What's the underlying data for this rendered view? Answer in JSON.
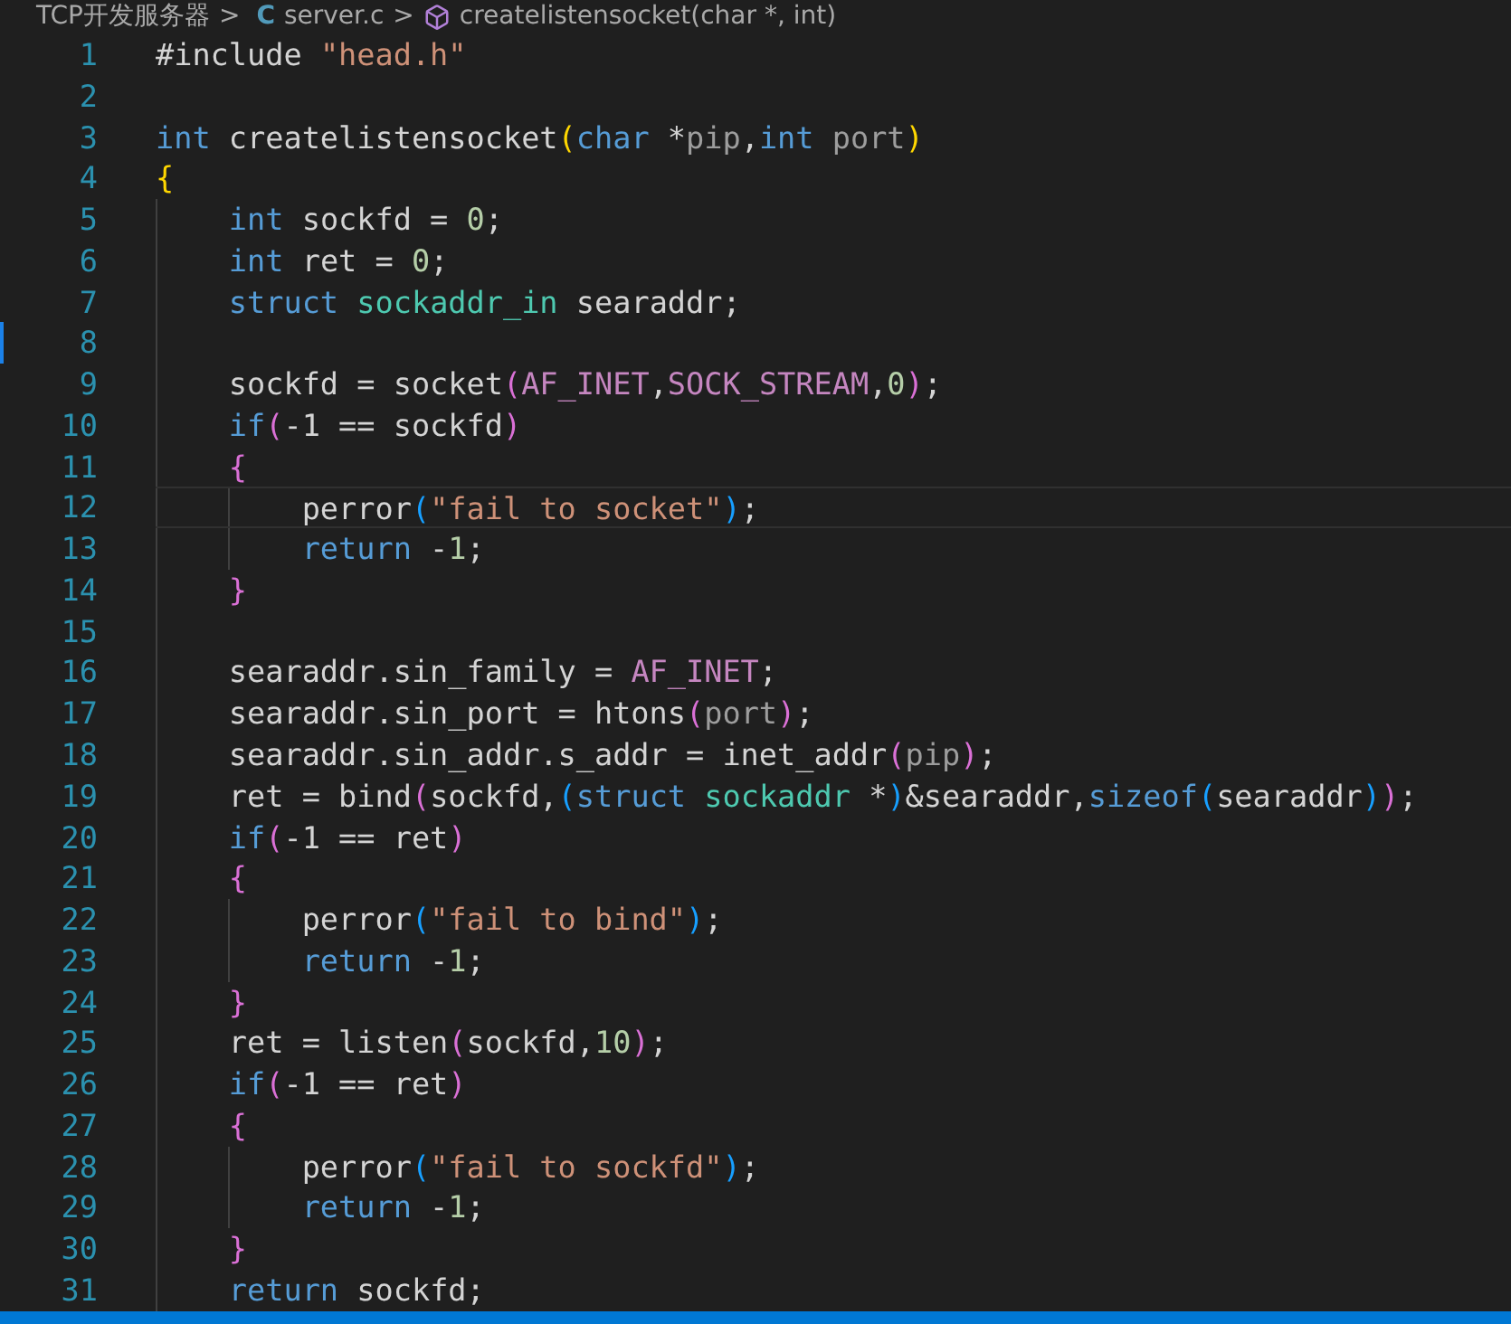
{
  "breadcrumb": [
    {
      "kind": "folder",
      "text": "TCP开发服务器"
    },
    {
      "kind": "c-file",
      "icon": "C",
      "text": "server.c"
    },
    {
      "kind": "symbol",
      "text": "createlistensocket(char *, int)"
    }
  ],
  "separator": ">",
  "lines": [
    {
      "number": "1",
      "tokens": [
        {
          "kind": "plain",
          "text": "#include "
        },
        {
          "kind": "string",
          "text": "\"head.h\""
        }
      ]
    },
    {
      "number": "2"
    },
    {
      "number": "3",
      "tokens": [
        {
          "kind": "keyword",
          "text": "int"
        },
        {
          "kind": "plain",
          "text": " createlistensocket"
        },
        {
          "kind": "bracket1",
          "text": "("
        },
        {
          "kind": "keyword",
          "text": "char"
        },
        {
          "kind": "plain",
          "text": " *"
        },
        {
          "kind": "param",
          "text": "pip"
        },
        {
          "kind": "plain",
          "text": ","
        },
        {
          "kind": "keyword",
          "text": "int"
        },
        {
          "kind": "param",
          "text": " port"
        },
        {
          "kind": "bracket1",
          "text": ")"
        }
      ]
    },
    {
      "number": "4",
      "tokens": [
        {
          "kind": "bracket1",
          "text": "{"
        }
      ]
    },
    {
      "number": "5",
      "tokens": [
        {
          "kind": "keyword",
          "text": "    int"
        },
        {
          "kind": "plain",
          "text": " sockfd = "
        },
        {
          "kind": "number",
          "text": "0"
        },
        {
          "kind": "plain",
          "text": ";"
        }
      ]
    },
    {
      "number": "6",
      "tokens": [
        {
          "kind": "keyword",
          "text": "    int"
        },
        {
          "kind": "plain",
          "text": " ret = "
        },
        {
          "kind": "number",
          "text": "0"
        },
        {
          "kind": "plain",
          "text": ";"
        }
      ]
    },
    {
      "number": "7",
      "tokens": [
        {
          "kind": "keyword",
          "text": "    struct"
        },
        {
          "kind": "type",
          "text": " sockaddr_in"
        },
        {
          "kind": "plain",
          "text": " searaddr;"
        }
      ]
    },
    {
      "number": "8",
      "change_marker": true
    },
    {
      "number": "9",
      "tokens": [
        {
          "kind": "plain",
          "text": "    sockfd = socket"
        },
        {
          "kind": "bracket2",
          "text": "("
        },
        {
          "kind": "macro",
          "text": "AF_INET"
        },
        {
          "kind": "plain",
          "text": ","
        },
        {
          "kind": "macro",
          "text": "SOCK_STREAM"
        },
        {
          "kind": "plain",
          "text": ","
        },
        {
          "kind": "number",
          "text": "0"
        },
        {
          "kind": "bracket2",
          "text": ")"
        },
        {
          "kind": "plain",
          "text": ";"
        }
      ]
    },
    {
      "number": "10",
      "tokens": [
        {
          "kind": "keyword",
          "text": "    if"
        },
        {
          "kind": "bracket2",
          "text": "("
        },
        {
          "kind": "plain",
          "text": "-1 == sockfd"
        },
        {
          "kind": "bracket2",
          "text": ")"
        }
      ]
    },
    {
      "number": "11",
      "tokens": [
        {
          "kind": "bracket2",
          "text": "    {"
        }
      ]
    },
    {
      "number": "12",
      "current": true,
      "tokens": [
        {
          "kind": "plain",
          "text": "        perror"
        },
        {
          "kind": "bracket3",
          "text": "("
        },
        {
          "kind": "string",
          "text": "\"fail to socket\""
        },
        {
          "kind": "bracket3",
          "text": ")"
        },
        {
          "kind": "plain",
          "text": ";"
        }
      ]
    },
    {
      "number": "13",
      "tokens": [
        {
          "kind": "keyword",
          "text": "        return"
        },
        {
          "kind": "plain",
          "text": " -"
        },
        {
          "kind": "number",
          "text": "1"
        },
        {
          "kind": "plain",
          "text": ";"
        }
      ]
    },
    {
      "number": "14",
      "tokens": [
        {
          "kind": "bracket2",
          "text": "    }"
        }
      ]
    },
    {
      "number": "15"
    },
    {
      "number": "16",
      "tokens": [
        {
          "kind": "plain",
          "text": "    searaddr.sin_family = "
        },
        {
          "kind": "macro",
          "text": "AF_INET"
        },
        {
          "kind": "plain",
          "text": ";"
        }
      ]
    },
    {
      "number": "17",
      "tokens": [
        {
          "kind": "plain",
          "text": "    searaddr.sin_port = htons"
        },
        {
          "kind": "bracket2",
          "text": "("
        },
        {
          "kind": "param",
          "text": "port"
        },
        {
          "kind": "bracket2",
          "text": ")"
        },
        {
          "kind": "plain",
          "text": ";"
        }
      ]
    },
    {
      "number": "18",
      "tokens": [
        {
          "kind": "plain",
          "text": "    searaddr.sin_addr.s_addr = inet_addr"
        },
        {
          "kind": "bracket2",
          "text": "("
        },
        {
          "kind": "param",
          "text": "pip"
        },
        {
          "kind": "bracket2",
          "text": ")"
        },
        {
          "kind": "plain",
          "text": ";"
        }
      ]
    },
    {
      "number": "19",
      "tokens": [
        {
          "kind": "plain",
          "text": "    ret = bind"
        },
        {
          "kind": "bracket2",
          "text": "("
        },
        {
          "kind": "plain",
          "text": "sockfd,"
        },
        {
          "kind": "bracket3",
          "text": "("
        },
        {
          "kind": "keyword",
          "text": "struct"
        },
        {
          "kind": "type",
          "text": " sockaddr"
        },
        {
          "kind": "plain",
          "text": " *"
        },
        {
          "kind": "bracket3",
          "text": ")"
        },
        {
          "kind": "plain",
          "text": "&searaddr,"
        },
        {
          "kind": "keyword",
          "text": "sizeof"
        },
        {
          "kind": "bracket3",
          "text": "("
        },
        {
          "kind": "plain",
          "text": "searaddr"
        },
        {
          "kind": "bracket3",
          "text": ")"
        },
        {
          "kind": "bracket2",
          "text": ")"
        },
        {
          "kind": "plain",
          "text": ";"
        }
      ]
    },
    {
      "number": "20",
      "tokens": [
        {
          "kind": "keyword",
          "text": "    if"
        },
        {
          "kind": "bracket2",
          "text": "("
        },
        {
          "kind": "plain",
          "text": "-1 == ret"
        },
        {
          "kind": "bracket2",
          "text": ")"
        }
      ]
    },
    {
      "number": "21",
      "tokens": [
        {
          "kind": "bracket2",
          "text": "    {"
        }
      ]
    },
    {
      "number": "22",
      "tokens": [
        {
          "kind": "plain",
          "text": "        perror"
        },
        {
          "kind": "bracket3",
          "text": "("
        },
        {
          "kind": "string",
          "text": "\"fail to bind\""
        },
        {
          "kind": "bracket3",
          "text": ")"
        },
        {
          "kind": "plain",
          "text": ";"
        }
      ]
    },
    {
      "number": "23",
      "tokens": [
        {
          "kind": "keyword",
          "text": "        return"
        },
        {
          "kind": "plain",
          "text": " -"
        },
        {
          "kind": "number",
          "text": "1"
        },
        {
          "kind": "plain",
          "text": ";"
        }
      ]
    },
    {
      "number": "24",
      "tokens": [
        {
          "kind": "bracket2",
          "text": "    }"
        }
      ]
    },
    {
      "number": "25",
      "tokens": [
        {
          "kind": "plain",
          "text": "    ret = listen"
        },
        {
          "kind": "bracket2",
          "text": "("
        },
        {
          "kind": "plain",
          "text": "sockfd,"
        },
        {
          "kind": "number",
          "text": "10"
        },
        {
          "kind": "bracket2",
          "text": ")"
        },
        {
          "kind": "plain",
          "text": ";"
        }
      ]
    },
    {
      "number": "26",
      "tokens": [
        {
          "kind": "keyword",
          "text": "    if"
        },
        {
          "kind": "bracket2",
          "text": "("
        },
        {
          "kind": "plain",
          "text": "-1 == ret"
        },
        {
          "kind": "bracket2",
          "text": ")"
        }
      ]
    },
    {
      "number": "27",
      "tokens": [
        {
          "kind": "bracket2",
          "text": "    {"
        }
      ]
    },
    {
      "number": "28",
      "tokens": [
        {
          "kind": "plain",
          "text": "        perror"
        },
        {
          "kind": "bracket3",
          "text": "("
        },
        {
          "kind": "string",
          "text": "\"fail to sockfd\""
        },
        {
          "kind": "bracket3",
          "text": ")"
        },
        {
          "kind": "plain",
          "text": ";"
        }
      ]
    },
    {
      "number": "29",
      "tokens": [
        {
          "kind": "keyword",
          "text": "        return"
        },
        {
          "kind": "plain",
          "text": " -"
        },
        {
          "kind": "number",
          "text": "1"
        },
        {
          "kind": "plain",
          "text": ";"
        }
      ]
    },
    {
      "number": "30",
      "tokens": [
        {
          "kind": "bracket2",
          "text": "    }"
        }
      ]
    },
    {
      "number": "31",
      "tokens": [
        {
          "kind": "keyword",
          "text": "    return"
        },
        {
          "kind": "plain",
          "text": " sockfd;"
        }
      ]
    }
  ]
}
